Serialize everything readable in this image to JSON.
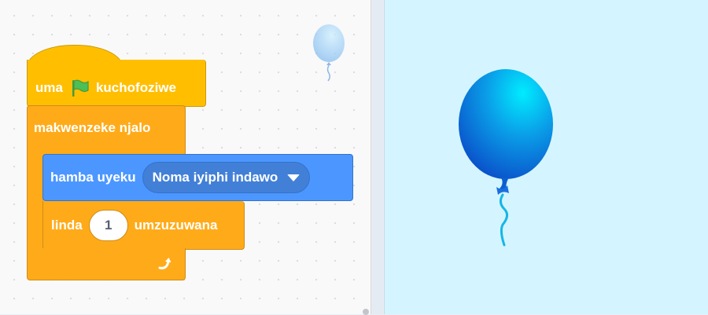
{
  "code_area": {
    "hat_block": {
      "before_flag": "uma",
      "after_flag": "kuchofoziwe",
      "icon": "green-flag-icon"
    },
    "forever_block": {
      "label": "makwenzeke njalo",
      "loop_icon": "loop-arrow-icon"
    },
    "goto_block": {
      "label": "hamba uyeku",
      "dropdown_value": "Noma iyiphi indawo"
    },
    "wait_block": {
      "label_before": "linda",
      "value": "1",
      "label_after": "umzuzuwana"
    },
    "sprite_thumbnail": {
      "icon": "balloon-icon"
    }
  },
  "stage": {
    "sprite": "balloon-icon"
  },
  "colors": {
    "event": "#ffbf00",
    "control": "#ffab19",
    "motion": "#4c97ff",
    "stage_bg": "#d4f5ff"
  }
}
